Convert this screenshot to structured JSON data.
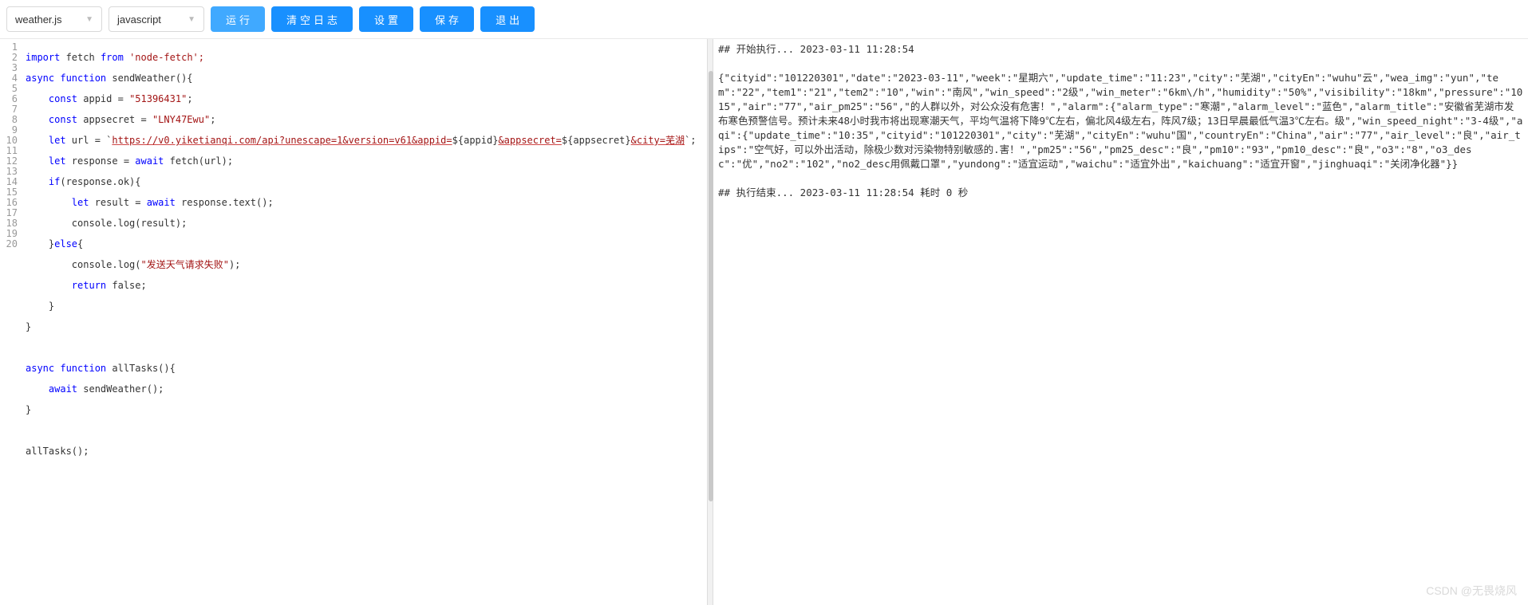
{
  "toolbar": {
    "filename": "weather.js",
    "language": "javascript",
    "buttons": {
      "run": "运行",
      "clear": "清空日志",
      "settings": "设置",
      "save": "保存",
      "exit": "退出"
    }
  },
  "gutter": [
    "1",
    "2",
    "3",
    "4",
    "5",
    "6",
    "7",
    "8",
    "9",
    "10",
    "11",
    "12",
    "13",
    "14",
    "15",
    "16",
    "17",
    "18",
    "19",
    "20"
  ],
  "code": {
    "l1a": "import",
    "l1b": " fetch ",
    "l1c": "from",
    "l1d": " 'node-fetch';",
    "l2a": "async function",
    "l2b": " sendWeather(){",
    "l3a": "    const",
    "l3b": " appid = ",
    "l3c": "\"51396431\"",
    "l3d": ";",
    "l4a": "    const",
    "l4b": " appsecret = ",
    "l4c": "\"LNY47Ewu\"",
    "l4d": ";",
    "l5a": "    let",
    "l5b": " url = `",
    "l5c": "https://v0.yiketianqi.com/api?unescape=1&version=v61&appid=",
    "l5d": "${appid}",
    "l5e": "&appsecret=",
    "l5f": "${appsecret}",
    "l5g": "&city=芜湖",
    "l5h": "`;",
    "l6a": "    let",
    "l6b": " response = ",
    "l6c": "await",
    "l6d": " fetch(url);",
    "l7a": "    if",
    "l7b": "(response.ok){",
    "l8a": "        let",
    "l8b": " result = ",
    "l8c": "await",
    "l8d": " response.text();",
    "l9": "        console.log(result);",
    "l10a": "    }",
    "l10b": "else",
    "l10c": "{",
    "l11a": "        console.log(",
    "l11b": "\"发送天气请求失败\"",
    "l11c": ");",
    "l12a": "        return",
    "l12b": " false;",
    "l13": "    }",
    "l14": "}",
    "l15": "",
    "l16a": "async function",
    "l16b": " allTasks(){",
    "l17a": "    await",
    "l17b": " sendWeather();",
    "l18": "}",
    "l19": "",
    "l20": "allTasks();"
  },
  "console": {
    "start": "## 开始执行... 2023-03-11 11:28:54",
    "body": "{\"cityid\":\"101220301\",\"date\":\"2023-03-11\",\"week\":\"星期六\",\"update_time\":\"11:23\",\"city\":\"芜湖\",\"cityEn\":\"wuhu\"云\",\"wea_img\":\"yun\",\"tem\":\"22\",\"tem1\":\"21\",\"tem2\":\"10\",\"win\":\"南风\",\"win_speed\":\"2级\",\"win_meter\":\"6km\\/h\",\"humidity\":\"50%\",\"visibility\":\"18km\",\"pressure\":\"1015\",\"air\":\"77\",\"air_pm25\":\"56\",\"的人群以外，对公众没有危害！\",\"alarm\":{\"alarm_type\":\"寒潮\",\"alarm_level\":\"蓝色\",\"alarm_title\":\"安徽省芜湖市发布寒色预警信号。预计未来48小时我市将出现寒潮天气，平均气温将下降9℃左右，偏北风4级左右，阵风7级；13日早晨最低气温3℃左右。级\",\"win_speed_night\":\"3-4级\",\"aqi\":{\"update_time\":\"10:35\",\"cityid\":\"101220301\",\"city\":\"芜湖\",\"cityEn\":\"wuhu\"国\",\"countryEn\":\"China\",\"air\":\"77\",\"air_level\":\"良\",\"air_tips\":\"空气好，可以外出活动，除极少数对污染物特别敏感的.害！\",\"pm25\":\"56\",\"pm25_desc\":\"良\",\"pm10\":\"93\",\"pm10_desc\":\"良\",\"o3\":\"8\",\"o3_desc\":\"优\",\"no2\":\"102\",\"no2_desc用佩戴口罩\",\"yundong\":\"适宜运动\",\"waichu\":\"适宜外出\",\"kaichuang\":\"适宜开窗\",\"jinghuaqi\":\"关闭净化器\"}}",
    "end": "## 执行结束... 2023-03-11 11:28:54 耗时 0 秒"
  },
  "watermark": "CSDN @无畏烧风"
}
